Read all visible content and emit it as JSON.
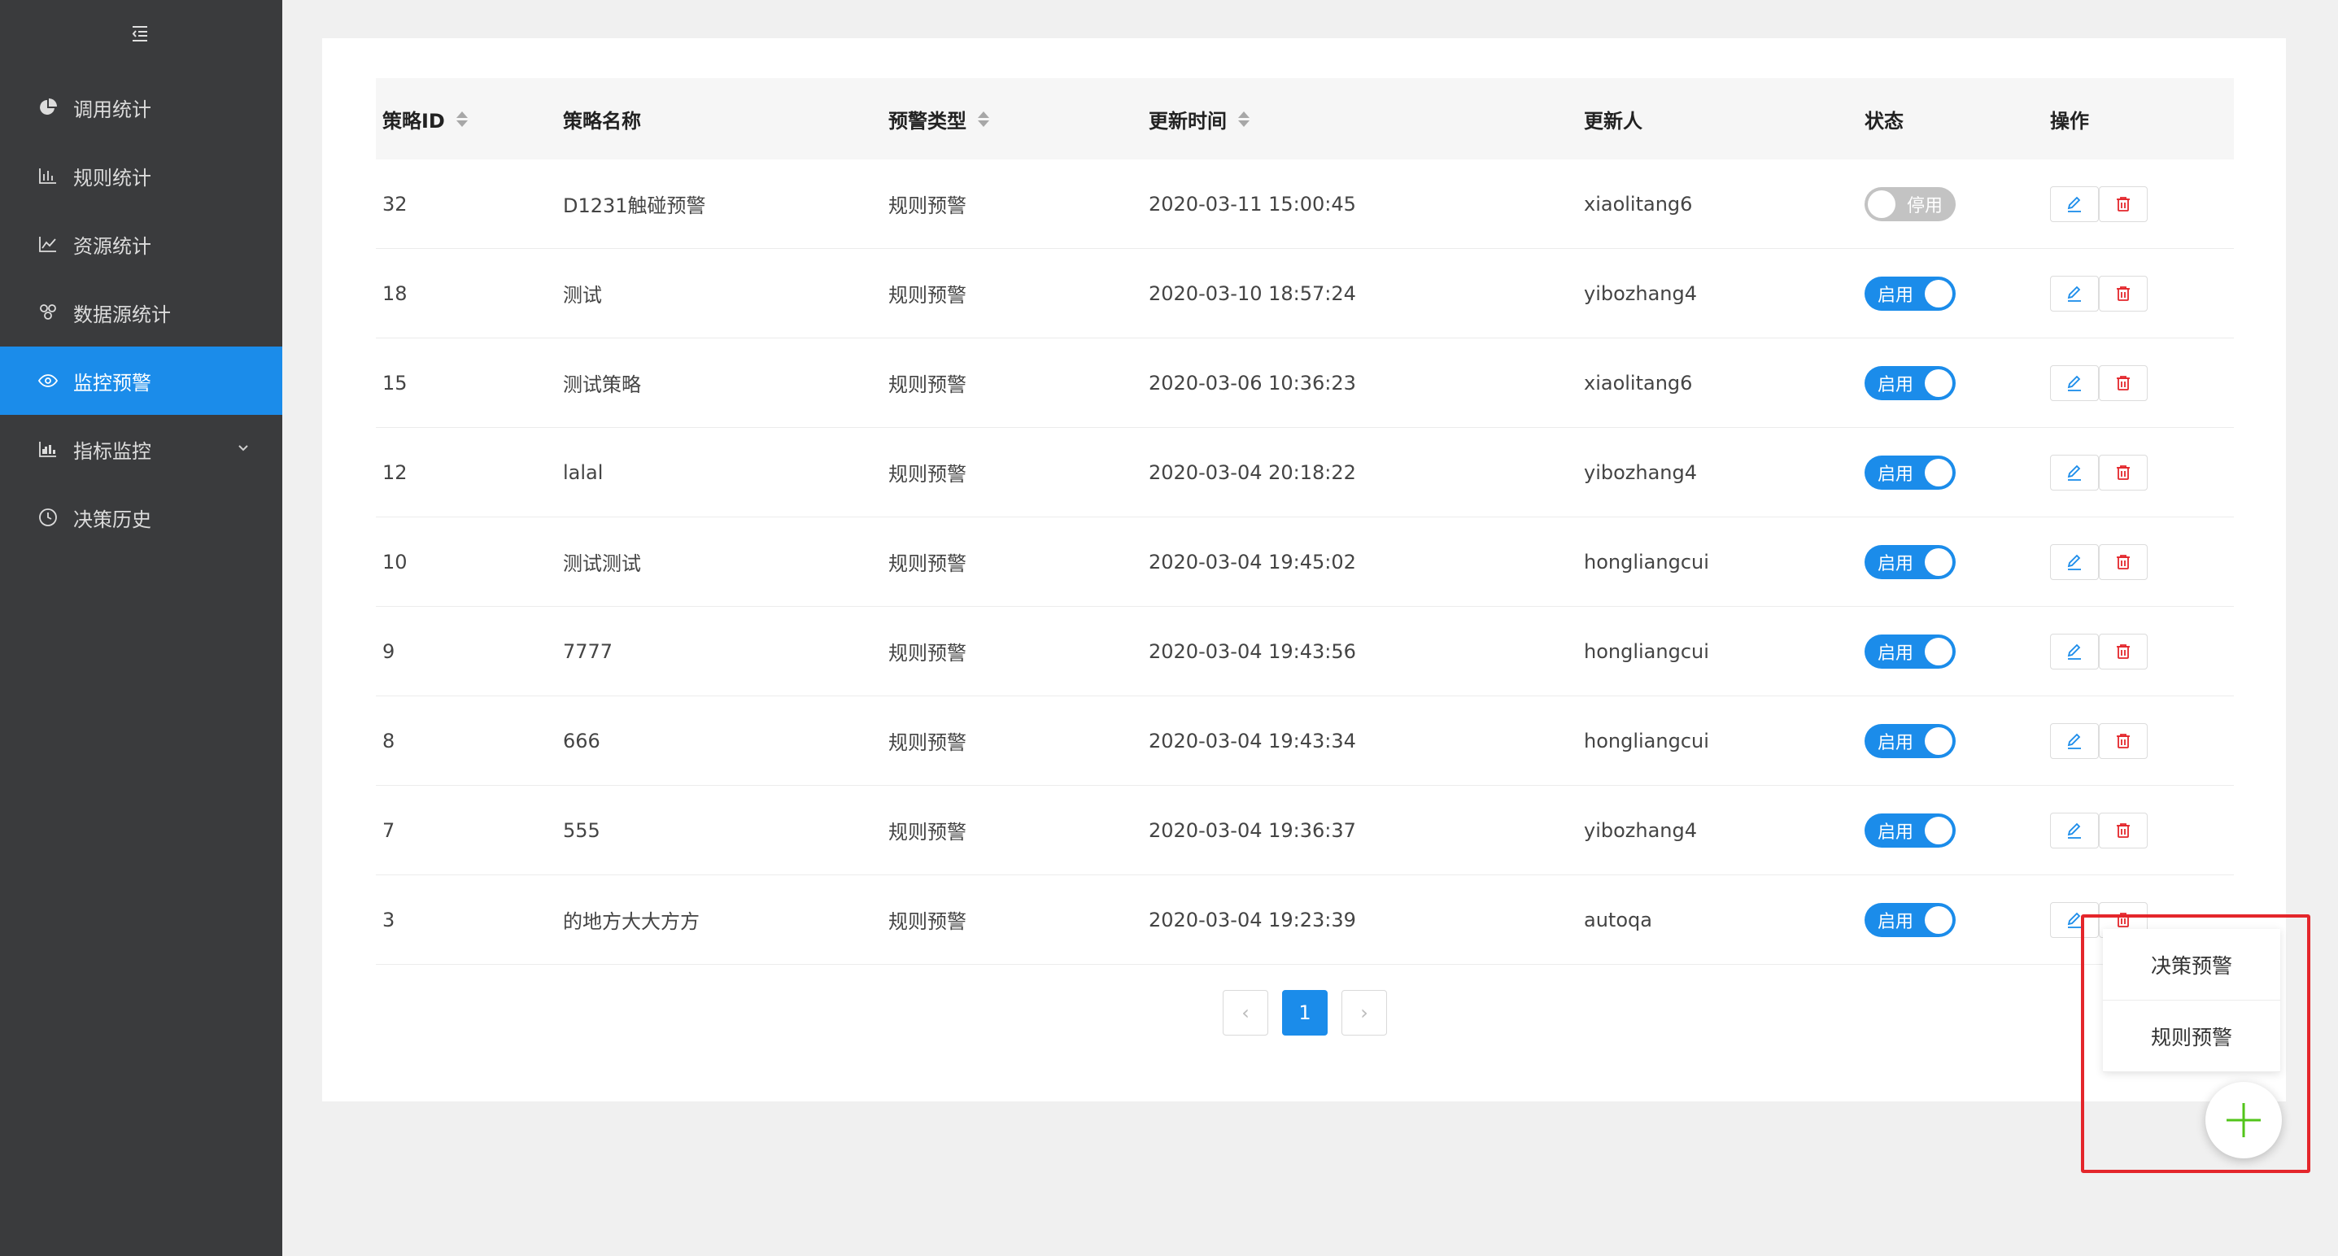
{
  "sidebar": {
    "items": [
      {
        "label": "调用统计",
        "icon": "pie-chart-icon"
      },
      {
        "label": "规则统计",
        "icon": "bar-chart-icon"
      },
      {
        "label": "资源统计",
        "icon": "line-chart-icon"
      },
      {
        "label": "数据源统计",
        "icon": "cluster-icon"
      },
      {
        "label": "监控预警",
        "icon": "eye-icon",
        "active": true
      },
      {
        "label": "指标监控",
        "icon": "area-chart-icon",
        "has_submenu": true
      },
      {
        "label": "决策历史",
        "icon": "clock-icon"
      }
    ]
  },
  "table": {
    "columns": [
      "策略ID",
      "策略名称",
      "预警类型",
      "更新时间",
      "更新人",
      "状态",
      "操作"
    ],
    "rows": [
      {
        "id": "32",
        "name": "D1231触碰预警",
        "type": "规则预警",
        "time": "2020-03-11 15:00:45",
        "user": "xiaolitang6",
        "status": "停用"
      },
      {
        "id": "18",
        "name": "测试",
        "type": "规则预警",
        "time": "2020-03-10 18:57:24",
        "user": "yibozhang4",
        "status": "启用"
      },
      {
        "id": "15",
        "name": "测试策略",
        "type": "规则预警",
        "time": "2020-03-06 10:36:23",
        "user": "xiaolitang6",
        "status": "启用"
      },
      {
        "id": "12",
        "name": "lalal",
        "type": "规则预警",
        "time": "2020-03-04 20:18:22",
        "user": "yibozhang4",
        "status": "启用"
      },
      {
        "id": "10",
        "name": "测试测试",
        "type": "规则预警",
        "time": "2020-03-04 19:45:02",
        "user": "hongliangcui",
        "status": "启用"
      },
      {
        "id": "9",
        "name": "7777",
        "type": "规则预警",
        "time": "2020-03-04 19:43:56",
        "user": "hongliangcui",
        "status": "启用"
      },
      {
        "id": "8",
        "name": "666",
        "type": "规则预警",
        "time": "2020-03-04 19:43:34",
        "user": "hongliangcui",
        "status": "启用"
      },
      {
        "id": "7",
        "name": "555",
        "type": "规则预警",
        "time": "2020-03-04 19:36:37",
        "user": "yibozhang4",
        "status": "启用"
      },
      {
        "id": "3",
        "name": "的地方大大方方",
        "type": "规则预警",
        "time": "2020-03-04 19:23:39",
        "user": "autoqa",
        "status": "启用"
      }
    ]
  },
  "pagination": {
    "current": "1",
    "prev": "‹",
    "next": "›"
  },
  "fab_menu": {
    "items": [
      "决策预警",
      "规则预警"
    ]
  },
  "colors": {
    "accent": "#1b8cea",
    "sidebar_bg": "#3a3b3d",
    "danger": "#e4262b",
    "fab_plus": "#52c41a"
  }
}
